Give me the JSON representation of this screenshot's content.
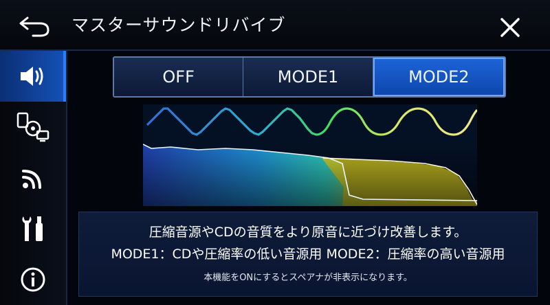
{
  "header": {
    "title": "マスターサウンドリバイブ",
    "back_icon": "back-arrow-icon",
    "close_icon": "close-icon"
  },
  "sidebar": {
    "items": [
      {
        "icon": "speaker-icon",
        "active": true
      },
      {
        "icon": "media-source-icon",
        "active": false
      },
      {
        "icon": "wireless-icon",
        "active": false
      },
      {
        "icon": "tools-icon",
        "active": false
      },
      {
        "icon": "info-icon",
        "active": false
      }
    ]
  },
  "mode": {
    "options": [
      "OFF",
      "MODE1",
      "MODE2"
    ],
    "selected": "MODE2"
  },
  "description": {
    "line1": "圧縮音源やCDの音質をより原音に近づけ改善します。",
    "line2": "MODE1：CDや圧縮率の低い音源用 MODE2：圧縮率の高い音源用",
    "line3": "本機能をONにするとスペアナが非表示になります。"
  },
  "colors": {
    "accent": "#1d63d6",
    "header_bg": "#0b0f18",
    "panel_bg": "#0e1c3a"
  }
}
